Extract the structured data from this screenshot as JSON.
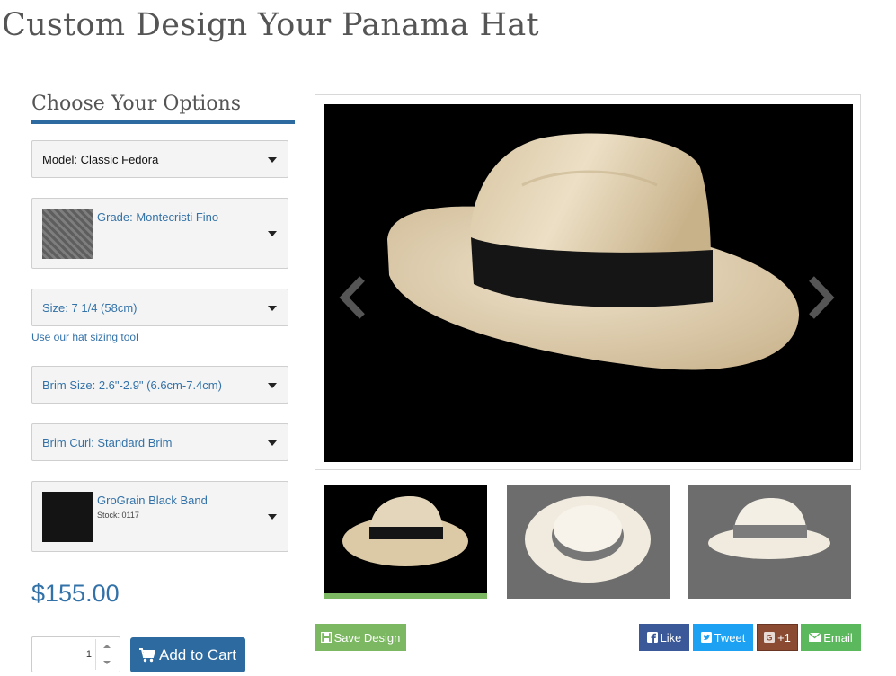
{
  "page": {
    "title": "Custom Design Your Panama Hat"
  },
  "options": {
    "heading": "Choose Your Options",
    "model": "Model: Classic Fedora",
    "grade": "Grade: Montecristi Fino",
    "size": "Size: 7 1/4 (58cm)",
    "sizing_link": "Use our hat sizing tool",
    "brim_size": "Brim Size: 2.6\"-2.9\" (6.6cm-7.4cm)",
    "brim_curl": "Brim Curl: Standard Brim",
    "band": "GroGrain Black Band",
    "band_stock": "Stock: 0117"
  },
  "purchase": {
    "price": "$155.00",
    "quantity": "1",
    "add_to_cart": "Add to Cart"
  },
  "actions": {
    "save_design": "Save Design",
    "like": "Like",
    "tweet": "Tweet",
    "gplus": "+1",
    "email": "Email"
  },
  "colors": {
    "accent": "#2d6aa0",
    "link": "#3372a8",
    "save": "#7cb862",
    "facebook": "#3b5998",
    "twitter": "#1da1f2",
    "gplus": "#8b4b33",
    "email": "#5cb85c"
  },
  "icons": {
    "select_caret": "caret-down-icon",
    "carousel_prev": "chevron-left-icon",
    "carousel_next": "chevron-right-icon",
    "cart": "shopping-cart-icon",
    "save": "floppy-disk-icon",
    "facebook": "facebook-icon",
    "twitter": "twitter-icon",
    "gplus": "google-plus-icon",
    "email": "envelope-icon"
  },
  "gallery": {
    "active_thumbnail": 0
  }
}
